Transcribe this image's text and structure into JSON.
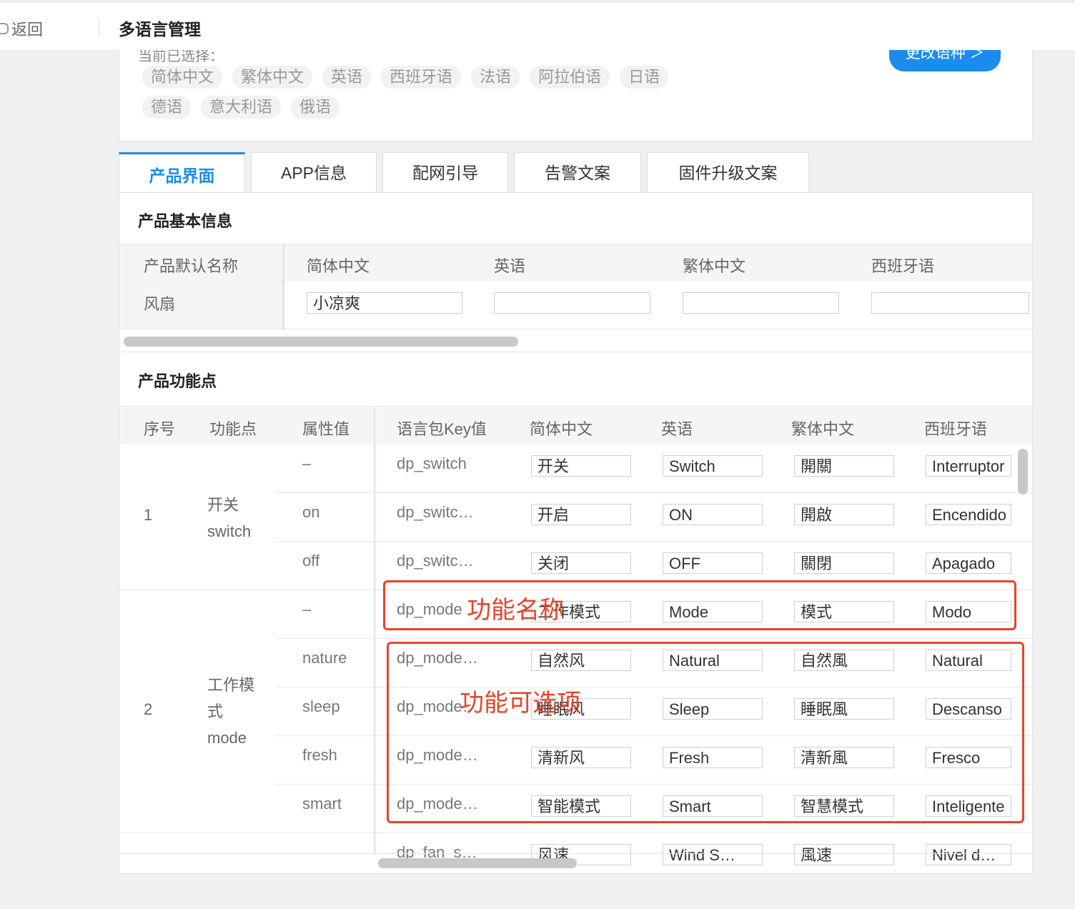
{
  "header": {
    "back_label": "返回",
    "title": "多语言管理"
  },
  "selected": {
    "label": "当前已选择：",
    "languages": [
      "简体中文",
      "繁体中文",
      "英语",
      "西班牙语",
      "法语",
      "阿拉伯语",
      "日语",
      "德语",
      "意大利语",
      "俄语"
    ],
    "change_button": "更改语种 ＞"
  },
  "tabs": [
    "产品界面",
    "APP信息",
    "配网引导",
    "告警文案",
    "固件升级文案"
  ],
  "basic": {
    "title": "产品基本信息",
    "headers": [
      "产品默认名称",
      "简体中文",
      "英语",
      "繁体中文",
      "西班牙语"
    ],
    "row": {
      "default_name": "风扇",
      "values": [
        "小凉爽",
        "",
        "",
        ""
      ]
    }
  },
  "features": {
    "title": "产品功能点",
    "headers": [
      "序号",
      "功能点",
      "属性值",
      "语言包Key值",
      "简体中文",
      "英语",
      "繁体中文",
      "西班牙语"
    ],
    "groups": [
      {
        "index": "1",
        "name": "开关\nswitch"
      },
      {
        "index": "2",
        "name": "工作模\n式\nmode"
      }
    ],
    "rows": [
      {
        "attr": "–",
        "key": "dp_switch",
        "zh": "开关",
        "en": "Switch",
        "tw": "開關",
        "es": "Interruptor"
      },
      {
        "attr": "on",
        "key": "dp_switc…",
        "zh": "开启",
        "en": "ON",
        "tw": "開啟",
        "es": "Encendido"
      },
      {
        "attr": "off",
        "key": "dp_switc…",
        "zh": "关闭",
        "en": "OFF",
        "tw": "關閉",
        "es": "Apagado"
      },
      {
        "attr": "–",
        "key": "dp_mode",
        "zh": "工作模式",
        "en": "Mode",
        "tw": "模式",
        "es": "Modo"
      },
      {
        "attr": "nature",
        "key": "dp_mode…",
        "zh": "自然风",
        "en": "Natural",
        "tw": "自然風",
        "es": "Natural"
      },
      {
        "attr": "sleep",
        "key": "dp_mode…",
        "zh": "睡眠风",
        "en": "Sleep",
        "tw": "睡眠風",
        "es": "Descanso"
      },
      {
        "attr": "fresh",
        "key": "dp_mode…",
        "zh": "清新风",
        "en": "Fresh",
        "tw": "清新風",
        "es": "Fresco"
      },
      {
        "attr": "smart",
        "key": "dp_mode…",
        "zh": "智能模式",
        "en": "Smart",
        "tw": "智慧模式",
        "es": "Inteligente"
      },
      {
        "attr": "",
        "key": "dp_fan_s…",
        "zh": "风速",
        "en": "Wind S…",
        "tw": "風速",
        "es": "Nivel d…"
      }
    ]
  },
  "annotations": {
    "name_label": "功能名称",
    "options_label": "功能可选项"
  },
  "colors": {
    "accent": "#1a8cf0",
    "annotation": "#e8432a"
  }
}
